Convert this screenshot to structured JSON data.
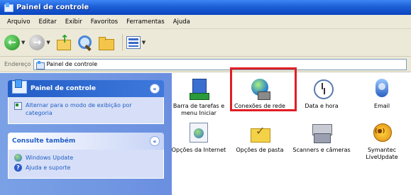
{
  "window": {
    "title": "Painel de controle"
  },
  "menu": [
    "Arquivo",
    "Editar",
    "Exibir",
    "Favoritos",
    "Ferramentas",
    "Ajuda"
  ],
  "address": {
    "label": "Endereço",
    "value": "Painel de controle"
  },
  "left_pane": {
    "control_panel": {
      "title": "Painel de controle",
      "collapse_glyph": "«",
      "links": [
        {
          "label": "Alternar para o modo de exibição por categoria",
          "icon": "switch-view-icon"
        }
      ]
    },
    "see_also": {
      "title": "Consulte também",
      "collapse_glyph": "«",
      "links": [
        {
          "label": "Windows Update",
          "icon": "windows-update-icon"
        },
        {
          "label": "Ajuda e suporte",
          "icon": "help-icon"
        }
      ]
    }
  },
  "items": [
    {
      "label": "Barra de tarefas e menu Iniciar",
      "icon": "taskbar-icon",
      "highlighted": false
    },
    {
      "label": "Conexões de rede",
      "icon": "network-connections-icon",
      "highlighted": true,
      "highlight_color": "#e01e24"
    },
    {
      "label": "Data e hora",
      "icon": "clock-icon",
      "highlighted": false
    },
    {
      "label": "Email",
      "icon": "mail-icon",
      "highlighted": false
    },
    {
      "label": "Opções da Internet",
      "icon": "internet-options-icon",
      "highlighted": false
    },
    {
      "label": "Opções de pasta",
      "icon": "folder-options-icon",
      "highlighted": false
    },
    {
      "label": "Scanners e câmeras",
      "icon": "scanner-icon",
      "highlighted": false
    },
    {
      "label": "Symantec LiveUpdate",
      "icon": "liveupdate-icon",
      "highlighted": false
    }
  ]
}
